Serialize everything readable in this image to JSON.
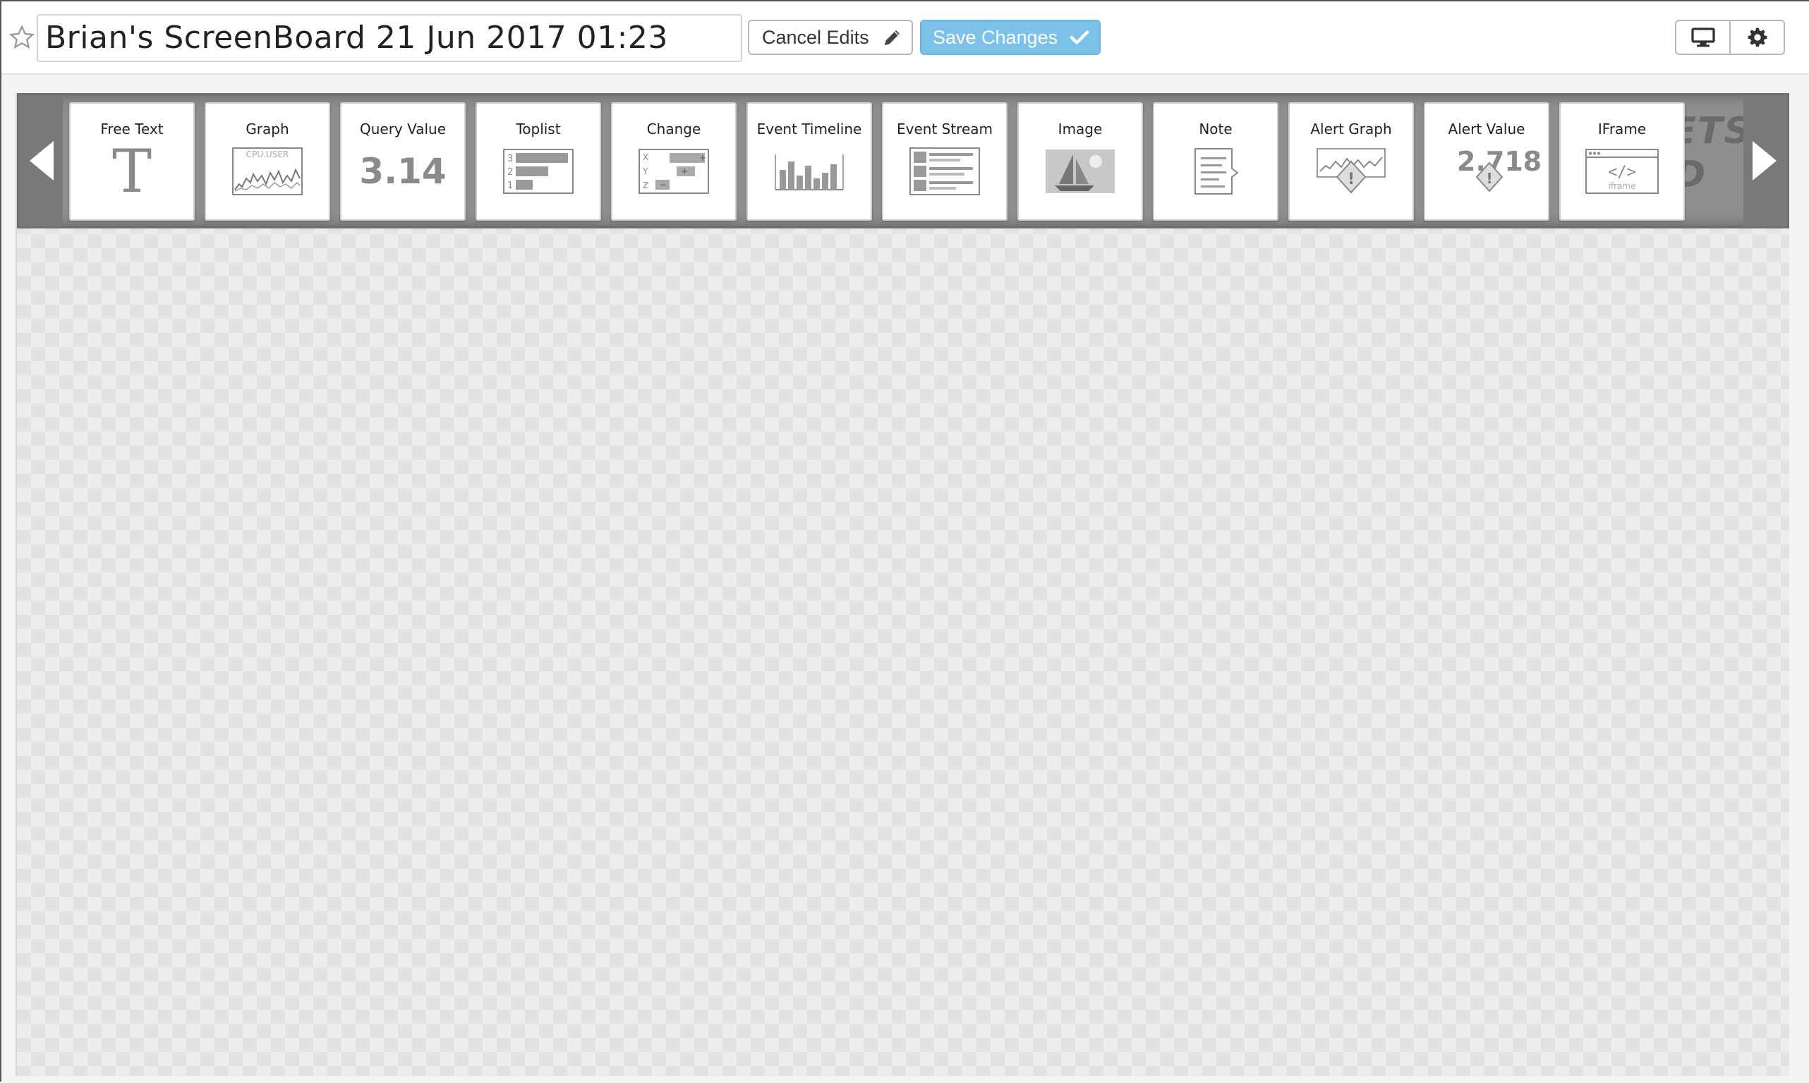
{
  "header": {
    "title": "Brian's ScreenBoard 21 Jun 2017 01:23",
    "cancel_label": "Cancel Edits",
    "save_label": "Save Changes",
    "star_icon": "star-icon",
    "tv_icon": "monitor-icon",
    "settings_icon": "gear-icon"
  },
  "tray": {
    "background_text_line1": "GETS",
    "background_text_line2": "RD",
    "widgets": [
      {
        "label": "Free Text",
        "icon": "free-text-icon",
        "glyph": "T"
      },
      {
        "label": "Graph",
        "icon": "graph-icon",
        "glyph": "CPU.USER"
      },
      {
        "label": "Query Value",
        "icon": "query-value-icon",
        "glyph": "3.14"
      },
      {
        "label": "Toplist",
        "icon": "toplist-icon",
        "glyph": ""
      },
      {
        "label": "Change",
        "icon": "change-icon",
        "glyph": ""
      },
      {
        "label": "Event Timeline",
        "icon": "event-timeline-icon",
        "glyph": ""
      },
      {
        "label": "Event Stream",
        "icon": "event-stream-icon",
        "glyph": ""
      },
      {
        "label": "Image",
        "icon": "image-icon",
        "glyph": ""
      },
      {
        "label": "Note",
        "icon": "note-icon",
        "glyph": ""
      },
      {
        "label": "Alert Graph",
        "icon": "alert-graph-icon",
        "glyph": "!"
      },
      {
        "label": "Alert Value",
        "icon": "alert-value-icon",
        "glyph": "2.718"
      },
      {
        "label": "IFrame",
        "icon": "iframe-icon",
        "glyph": "iframe"
      }
    ]
  },
  "colors": {
    "save_button": "#7cc1e8",
    "tray": "#8e8e8e"
  }
}
